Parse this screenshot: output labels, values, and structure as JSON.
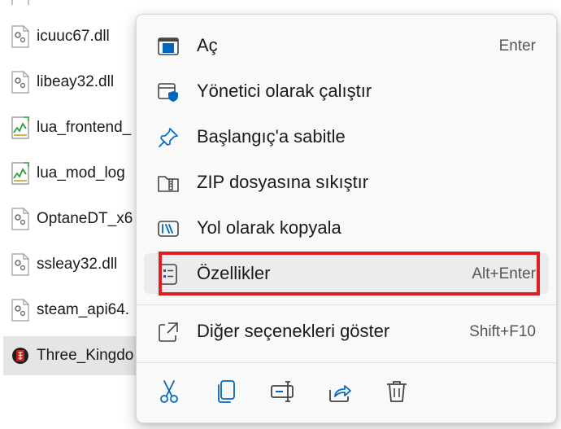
{
  "files": [
    {
      "name": "icuuc67.dll",
      "icon": "dll-file-icon"
    },
    {
      "name": "libeay32.dll",
      "icon": "dll-file-icon"
    },
    {
      "name": "lua_frontend_",
      "icon": "log-file-icon"
    },
    {
      "name": "lua_mod_log",
      "icon": "log-file-icon"
    },
    {
      "name": "OptaneDT_x6",
      "icon": "dll-file-icon"
    },
    {
      "name": "ssleay32.dll",
      "icon": "dll-file-icon"
    },
    {
      "name": "steam_api64.",
      "icon": "dll-file-icon"
    },
    {
      "name": "Three_Kingdo",
      "icon": "game-exe-icon"
    }
  ],
  "context_menu": {
    "items": [
      {
        "label": "Aç",
        "shortcut": "Enter",
        "icon": "open-icon"
      },
      {
        "label": "Yönetici olarak çalıştır",
        "shortcut": "",
        "icon": "run-as-admin-icon"
      },
      {
        "label": "Başlangıç'a sabitle",
        "shortcut": "",
        "icon": "pin-icon"
      },
      {
        "label": "ZIP dosyasına sıkıştır",
        "shortcut": "",
        "icon": "zip-folder-icon"
      },
      {
        "label": "Yol olarak kopyala",
        "shortcut": "",
        "icon": "copy-path-icon"
      },
      {
        "label": "Özellikler",
        "shortcut": "Alt+Enter",
        "icon": "properties-icon"
      },
      {
        "label": "Diğer seçenekleri göster",
        "shortcut": "Shift+F10",
        "icon": "more-options-icon"
      }
    ],
    "toolbar": [
      "cut-icon",
      "copy-icon",
      "rename-icon",
      "share-icon",
      "delete-icon"
    ]
  },
  "colors": {
    "accent": "#0067c0",
    "highlight_border": "#e31c23",
    "menu_background": "#f9f9f9",
    "selected_row": "#e5e5e5"
  }
}
